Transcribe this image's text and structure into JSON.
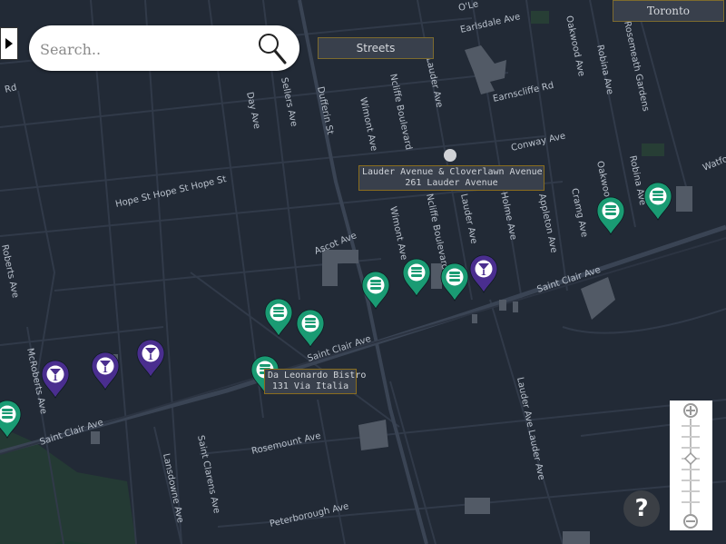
{
  "search": {
    "placeholder": "Search.."
  },
  "layer_button": "Streets",
  "city_button": "Toronto",
  "tooltips": {
    "address": {
      "line1": "Lauder Avenue & Cloverlawn Avenue",
      "line2": "261 Lauder Avenue"
    },
    "place": {
      "line1": "Da Leonardo Bistro",
      "line2": "131 Via Italia"
    }
  },
  "help_label": "?",
  "streets": {
    "earlsdale": "Earlsdale Ave",
    "o_leary": "O'Le",
    "oakwood_top": "Oakwood Ave",
    "robina_top": "Robina Ave",
    "rosemeath": "Rosemeath Gardens",
    "earnscliffe": "Earnscliffe Rd",
    "lauder_top": "Lauder Ave",
    "ncliffe_top": "Ncliffe Boulevard",
    "wimont_top": "Wimont Ave",
    "dufferin_top": "Dufferin St",
    "sellers": "Sellers Ave",
    "day": "Day Ave",
    "conway": "Conway Ave",
    "hope": "Hope St Hope St Hope St",
    "ascot": "Ascot Ave",
    "wimont_mid": "Wimont Ave",
    "ncliffe_mid": "Ncliffe Boulevard",
    "lauder_mid": "Lauder Ave",
    "holme": "Holme Ave",
    "appleton": "Appleton Ave",
    "cramg": "Cramg Ave",
    "oakwood_mid": "Oakwood Ave",
    "robina_mid": "Robina Ave",
    "watford": "Watfo",
    "stclair_right": "Saint Clair Ave",
    "stclair_mid": "Saint Clair Ave",
    "stclair_left": "Saint Clair Ave",
    "mcroberts": "McRoberts Ave",
    "roberts": "Roberts Ave",
    "rd_left": "Rd",
    "lansdowne": "Lansdowne Ave",
    "st_clarens": "Saint Clarens Ave",
    "rosemount": "Rosemount Ave",
    "peterborough": "Peterborough Ave",
    "lauder_low": "Lauder Ave Lauder Ave"
  },
  "markers": [
    {
      "type": "restaurant",
      "color": "#1a9b73"
    },
    {
      "type": "bar",
      "color": "#4a2e8f"
    }
  ]
}
